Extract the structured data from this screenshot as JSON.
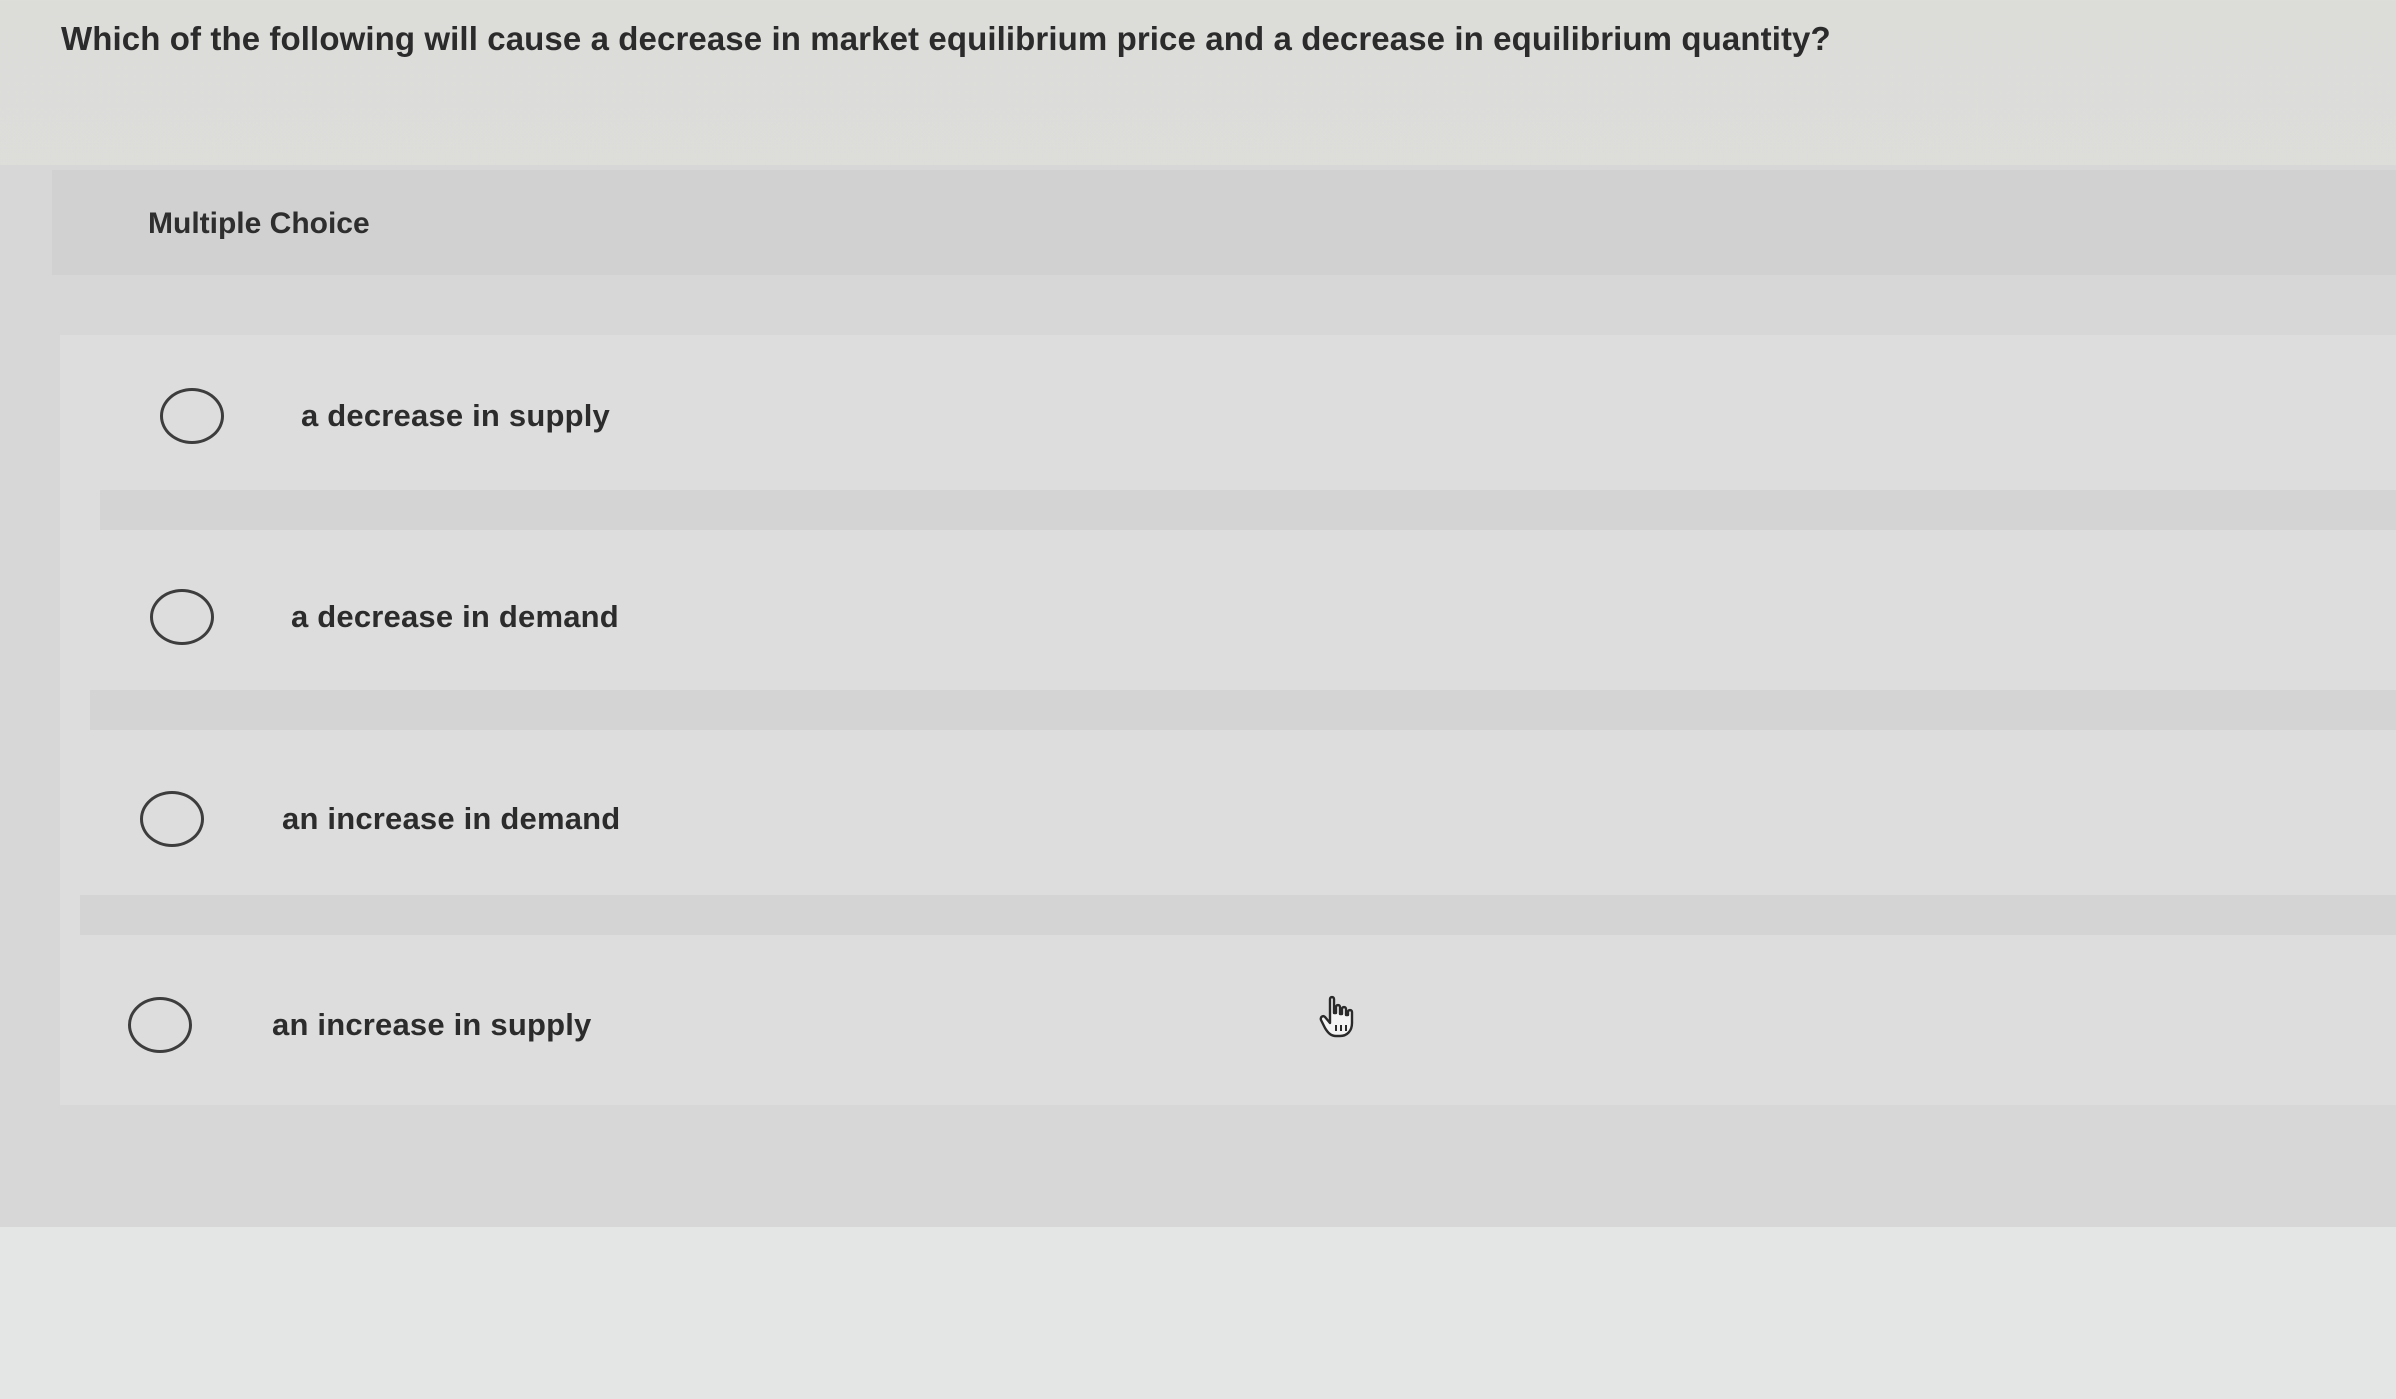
{
  "question": {
    "text": "Which of the following will cause a decrease in market equilibrium price and a decrease in equilibrium quantity?"
  },
  "section": {
    "label": "Multiple Choice"
  },
  "options": [
    {
      "label": "a decrease in supply"
    },
    {
      "label": "a decrease in demand"
    },
    {
      "label": "an increase in demand"
    },
    {
      "label": "an increase in supply"
    }
  ],
  "colors": {
    "text": "#2b2b2c",
    "panel": "#d6d7d6",
    "radio_border": "#3d3d3d"
  }
}
